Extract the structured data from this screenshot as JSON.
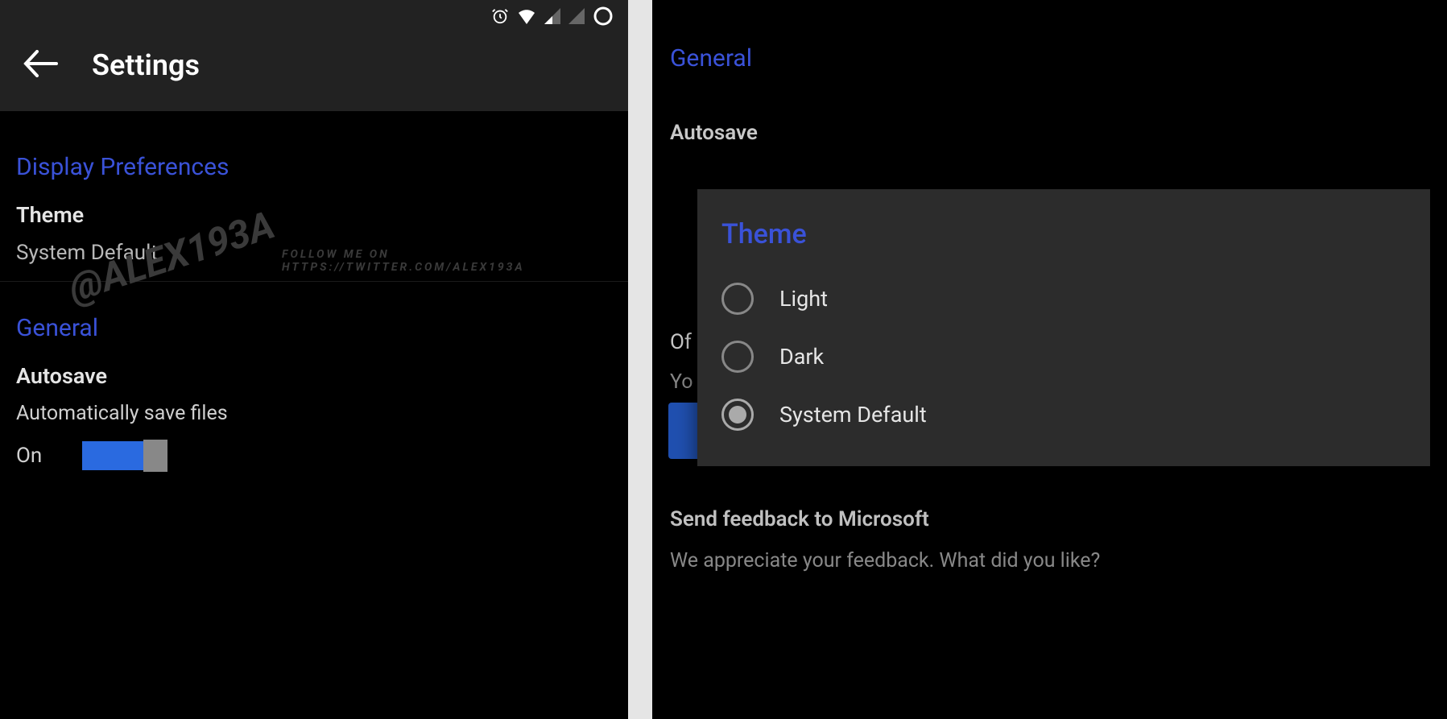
{
  "left": {
    "header": {
      "title": "Settings"
    },
    "display_preferences_label": "Display Preferences",
    "theme": {
      "title": "Theme",
      "value": "System Default"
    },
    "general_label": "General",
    "autosave": {
      "title": "Autosave",
      "sub": "Automatically save files",
      "state": "On"
    }
  },
  "right": {
    "general_label": "General",
    "autosave_title": "Autosave",
    "offline_prefix": "Of",
    "offline_sub_prefix": "Yo",
    "feedback": {
      "title": "Send feedback to Microsoft",
      "sub": "We appreciate your feedback.  What did you like?"
    },
    "dialog": {
      "title": "Theme",
      "options": [
        "Light",
        "Dark",
        "System Default"
      ],
      "selected_index": 2
    }
  },
  "watermark": {
    "handle": "@ALEX193A",
    "url": "FOLLOW ME ON HTTPS://TWITTER.COM/ALEX193A"
  }
}
